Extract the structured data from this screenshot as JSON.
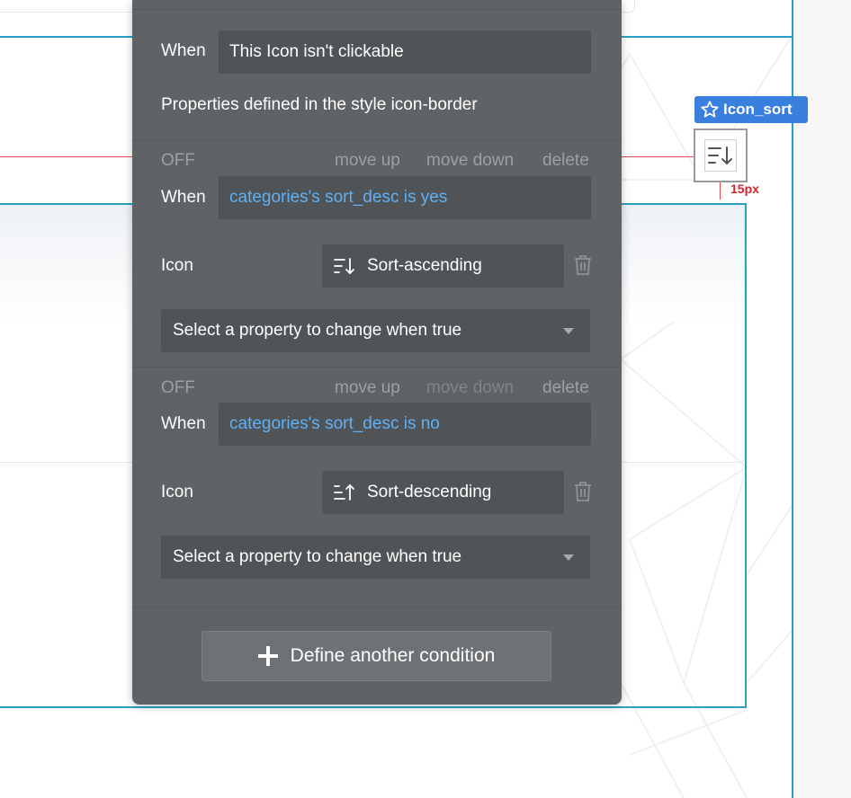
{
  "canvas": {
    "element_name": "Icon_sort",
    "margin_label": "15px"
  },
  "panel": {
    "base_condition": {
      "when_label": "When",
      "when_value": "This Icon isn't clickable",
      "style_note": "Properties defined in the style icon-border"
    },
    "conditions": [
      {
        "state_label": "OFF",
        "move_up": "move up",
        "move_down": "move down",
        "delete": "delete",
        "when_label": "When",
        "expression": "categories's sort_desc is yes",
        "property_label": "Icon",
        "icon_value": "Sort-ascending",
        "icon_name": "sort-ascending-icon",
        "select_placeholder": "Select a property to change when true"
      },
      {
        "state_label": "OFF",
        "move_up": "move up",
        "move_down": "move down",
        "delete": "delete",
        "when_label": "When",
        "expression": "categories's sort_desc is no",
        "property_label": "Icon",
        "icon_value": "Sort-descending",
        "icon_name": "sort-descending-icon",
        "select_placeholder": "Select a property to change when true"
      }
    ],
    "define_button": "Define another condition"
  },
  "colors": {
    "panel_bg": "#5f6366",
    "field_bg": "#505457",
    "expression_blue": "#5fb0f5",
    "selection_blue": "#3a7fdd",
    "guide_cyan": "#27a2c4",
    "measure_red": "#d6262b"
  }
}
